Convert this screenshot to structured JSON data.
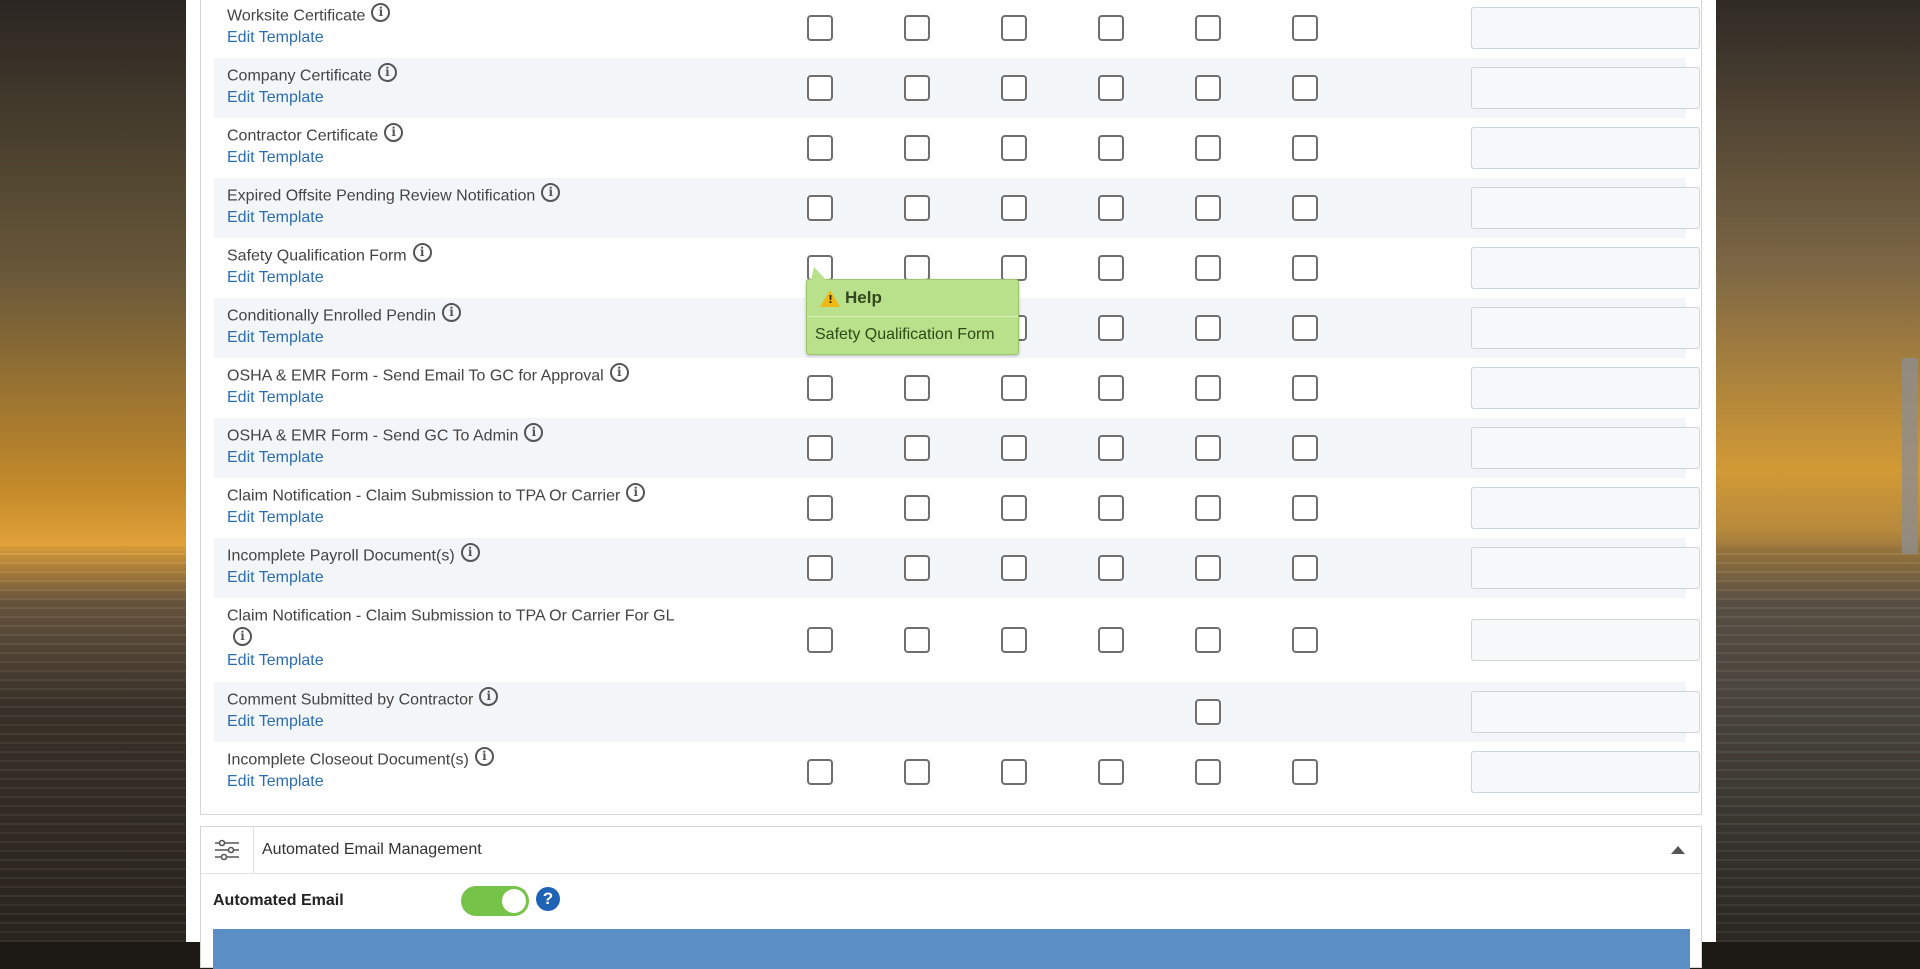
{
  "rows": [
    {
      "name": "Worksite Certificate",
      "edit": "Edit Template",
      "checks": [
        1,
        1,
        1,
        1,
        1,
        1
      ],
      "value": ""
    },
    {
      "name": "Company Certificate",
      "edit": "Edit Template",
      "checks": [
        1,
        1,
        1,
        1,
        1,
        1
      ],
      "value": ""
    },
    {
      "name": "Contractor Certificate",
      "edit": "Edit Template",
      "checks": [
        1,
        1,
        1,
        1,
        1,
        1
      ],
      "value": ""
    },
    {
      "name": "Expired Offsite Pending Review Notification",
      "edit": "Edit Template",
      "checks": [
        1,
        1,
        1,
        1,
        1,
        1
      ],
      "value": ""
    },
    {
      "name": "Safety Qualification Form",
      "edit": "Edit Template",
      "checks": [
        1,
        1,
        1,
        1,
        1,
        1
      ],
      "value": ""
    },
    {
      "name": "Conditionally Enrolled Pendin",
      "edit": "Edit Template",
      "checks": [
        1,
        1,
        1,
        1,
        1,
        1
      ],
      "value": ""
    },
    {
      "name": "OSHA & EMR Form - Send Email To GC for Approval",
      "edit": "Edit Template",
      "checks": [
        1,
        1,
        1,
        1,
        1,
        1
      ],
      "value": ""
    },
    {
      "name": "OSHA & EMR Form - Send GC To Admin",
      "edit": "Edit Template",
      "checks": [
        1,
        1,
        1,
        1,
        1,
        1
      ],
      "value": ""
    },
    {
      "name": "Claim Notification - Claim Submission to TPA Or Carrier",
      "edit": "Edit Template",
      "checks": [
        1,
        1,
        1,
        1,
        1,
        1
      ],
      "value": ""
    },
    {
      "name": "Incomplete Payroll Document(s)",
      "edit": "Edit Template",
      "checks": [
        1,
        1,
        1,
        1,
        1,
        1
      ],
      "value": ""
    },
    {
      "name": "Claim Notification - Claim Submission to TPA Or Carrier For GL",
      "edit": "Edit Template",
      "checks": [
        1,
        1,
        1,
        1,
        1,
        1
      ],
      "value": ""
    },
    {
      "name": "Comment Submitted by Contractor",
      "edit": "Edit Template",
      "checks": [
        0,
        0,
        0,
        0,
        1,
        0
      ],
      "value": ""
    },
    {
      "name": "Incomplete Closeout Document(s)",
      "edit": "Edit Template",
      "checks": [
        1,
        1,
        1,
        1,
        1,
        1
      ],
      "value": ""
    }
  ],
  "tooltip": {
    "title": "Help",
    "warning_icon": "!",
    "body": "Safety Qualification Form"
  },
  "section": {
    "title": "Automated Email Management",
    "automated_email_label": "Automated Email",
    "toggle_on": true,
    "help_icon": "?"
  },
  "colors": {
    "link": "#2a6db5",
    "tooltip_bg": "#b9e08a",
    "toggle_on": "#76c34a",
    "help_blue": "#1f63b5",
    "table_bar": "#5b8ec4"
  }
}
